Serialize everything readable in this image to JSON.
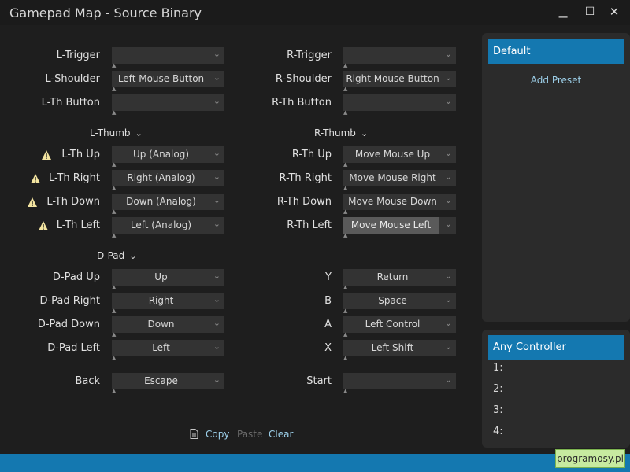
{
  "window": {
    "title": "Gamepad Map - Source Binary",
    "min": "▁",
    "max": "☐",
    "close": "✕"
  },
  "left": {
    "rows": [
      {
        "label": "L-Trigger",
        "value": ""
      },
      {
        "label": "L-Shoulder",
        "value": "Left Mouse Button"
      },
      {
        "label": "L-Th Button",
        "value": ""
      }
    ],
    "thumb_section": "L-Thumb",
    "thumb_rows": [
      {
        "label": "L-Th Up",
        "value": "Up (Analog)"
      },
      {
        "label": "L-Th Right",
        "value": "Right (Analog)"
      },
      {
        "label": "L-Th Down",
        "value": "Down (Analog)"
      },
      {
        "label": "L-Th Left",
        "value": "Left (Analog)"
      }
    ],
    "dpad_section": "D-Pad",
    "dpad_rows": [
      {
        "label": "D-Pad Up",
        "value": "Up"
      },
      {
        "label": "D-Pad Right",
        "value": "Right"
      },
      {
        "label": "D-Pad Down",
        "value": "Down"
      },
      {
        "label": "D-Pad Left",
        "value": "Left"
      }
    ],
    "back": {
      "label": "Back",
      "value": "Escape"
    }
  },
  "right": {
    "rows": [
      {
        "label": "R-Trigger",
        "value": ""
      },
      {
        "label": "R-Shoulder",
        "value": "Right Mouse Button"
      },
      {
        "label": "R-Th Button",
        "value": ""
      }
    ],
    "thumb_section": "R-Thumb",
    "thumb_rows": [
      {
        "label": "R-Th Up",
        "value": "Move Mouse Up"
      },
      {
        "label": "R-Th Right",
        "value": "Move Mouse Right"
      },
      {
        "label": "R-Th Down",
        "value": "Move Mouse Down"
      },
      {
        "label": "R-Th Left",
        "value": "Move Mouse Left"
      }
    ],
    "face_rows": [
      {
        "label": "Y",
        "value": "Return"
      },
      {
        "label": "B",
        "value": "Space"
      },
      {
        "label": "A",
        "value": "Left Control"
      },
      {
        "label": "X",
        "value": "Left Shift"
      }
    ],
    "start": {
      "label": "Start",
      "value": ""
    }
  },
  "actions": {
    "copy": "Copy",
    "paste": "Paste",
    "clear": "Clear"
  },
  "presets": {
    "header": "Default",
    "add_preset": "Add Preset"
  },
  "controllers": {
    "header": "Any Controller",
    "slots": [
      "1:",
      "2:",
      "3:",
      "4:"
    ]
  },
  "watermark": "programosy.pl",
  "colors": {
    "accent": "#1478b0",
    "warning": "#f3e4a0",
    "link": "#9dd0ea"
  },
  "icons": {
    "chevron": "chevron-down-icon",
    "warning": "warning-icon",
    "copy": "document-icon"
  }
}
